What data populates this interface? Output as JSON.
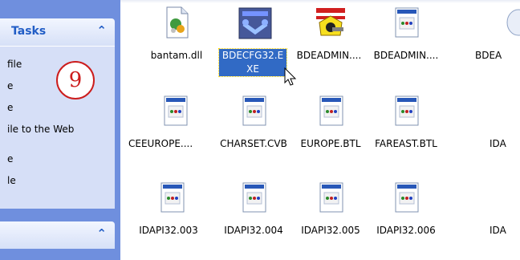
{
  "task_pane": {
    "tasks_title": "Tasks",
    "items": [
      {
        "label": "file",
        "icon": "task-icon"
      },
      {
        "label": "e",
        "icon": "task-icon"
      },
      {
        "label": "e",
        "icon": "task-icon"
      },
      {
        "label": "ile to the Web",
        "icon": "web-publish-icon"
      },
      {
        "label": "e",
        "icon": "task-icon"
      },
      {
        "label": "le",
        "icon": "task-icon"
      }
    ],
    "marker_number": "9"
  },
  "files": [
    {
      "name": "bantam.dll",
      "icon": "dll-icon"
    },
    {
      "name": "BDECFG32.EXE",
      "icon": "bde-config-icon",
      "selected": true
    },
    {
      "name": "BDEADMIN....",
      "icon": "bde-admin-icon"
    },
    {
      "name": "BDEADMIN....",
      "icon": "document-icon"
    },
    {
      "name": "BDEA",
      "icon": "document-icon"
    },
    {
      "name": "CEEUROPE....",
      "icon": "document-icon"
    },
    {
      "name": "CHARSET.CVB",
      "icon": "document-icon"
    },
    {
      "name": "EUROPE.BTL",
      "icon": "document-icon"
    },
    {
      "name": "FAREAST.BTL",
      "icon": "document-icon"
    },
    {
      "name": "IDA",
      "icon": "document-icon"
    },
    {
      "name": "IDAPI32.003",
      "icon": "document-icon"
    },
    {
      "name": "IDAPI32.004",
      "icon": "document-icon"
    },
    {
      "name": "IDAPI32.005",
      "icon": "document-icon"
    },
    {
      "name": "IDAPI32.006",
      "icon": "document-icon"
    },
    {
      "name": "IDA",
      "icon": "document-icon"
    }
  ],
  "colors": {
    "taskpane_bg": "#6f8fde",
    "taskpane_body": "#d6dff7",
    "header_text": "#215dc6",
    "selection": "#316ac5",
    "marker": "#cc1d1d"
  }
}
